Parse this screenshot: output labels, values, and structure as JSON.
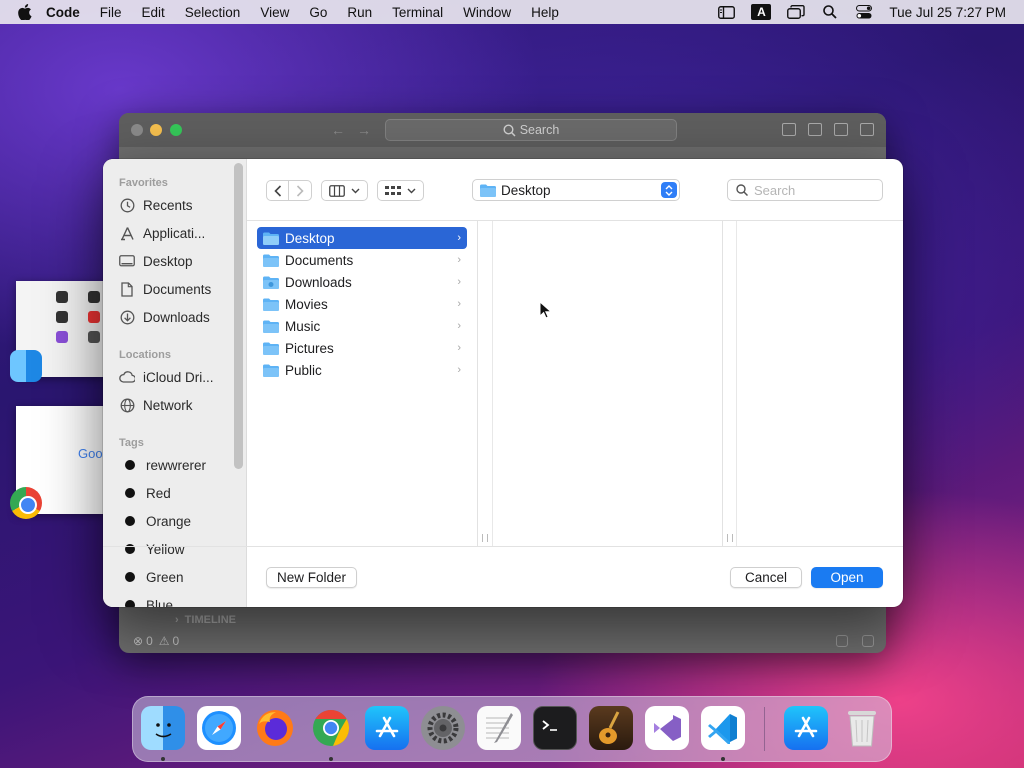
{
  "menubar": {
    "app_name": "Code",
    "items": [
      "File",
      "Edit",
      "Selection",
      "View",
      "Go",
      "Run",
      "Terminal",
      "Window",
      "Help"
    ],
    "input_indicator": "A",
    "clock": "Tue Jul 25  7:27 PM"
  },
  "code_window": {
    "search_placeholder": "Search",
    "timeline_label": "TIMELINE",
    "status_errors": "0",
    "status_warnings": "0"
  },
  "dialog": {
    "sidebar": {
      "favorites_header": "Favorites",
      "favorites": [
        {
          "label": "Recents",
          "icon": "clock-icon"
        },
        {
          "label": "Applicati...",
          "icon": "applications-icon"
        },
        {
          "label": "Desktop",
          "icon": "desktop-icon"
        },
        {
          "label": "Documents",
          "icon": "document-icon"
        },
        {
          "label": "Downloads",
          "icon": "download-icon"
        }
      ],
      "locations_header": "Locations",
      "locations": [
        {
          "label": "iCloud Dri...",
          "icon": "cloud-icon"
        },
        {
          "label": "Network",
          "icon": "globe-icon"
        }
      ],
      "tags_header": "Tags",
      "tags": [
        "rewwrerer",
        "Red",
        "Orange",
        "Yellow",
        "Green",
        "Blue"
      ]
    },
    "path_popup": "Desktop",
    "search_placeholder": "Search",
    "folders": [
      {
        "name": "Desktop",
        "selected": true
      },
      {
        "name": "Documents",
        "selected": false
      },
      {
        "name": "Downloads",
        "selected": false
      },
      {
        "name": "Movies",
        "selected": false
      },
      {
        "name": "Music",
        "selected": false
      },
      {
        "name": "Pictures",
        "selected": false
      },
      {
        "name": "Public",
        "selected": false
      }
    ],
    "new_folder_label": "New Folder",
    "cancel_label": "Cancel",
    "open_label": "Open"
  },
  "dock": {
    "apps": [
      "Finder",
      "Safari",
      "Firefox",
      "Chrome",
      "App Store",
      "System Settings",
      "TextEdit",
      "Terminal",
      "GarageBand",
      "Visual Studio",
      "Visual Studio Code",
      "App Store Downloads",
      "Trash"
    ]
  },
  "colors": {
    "accent": "#1a7bf2",
    "selection": "#2a66d6",
    "folder": "#5eb3f5"
  }
}
